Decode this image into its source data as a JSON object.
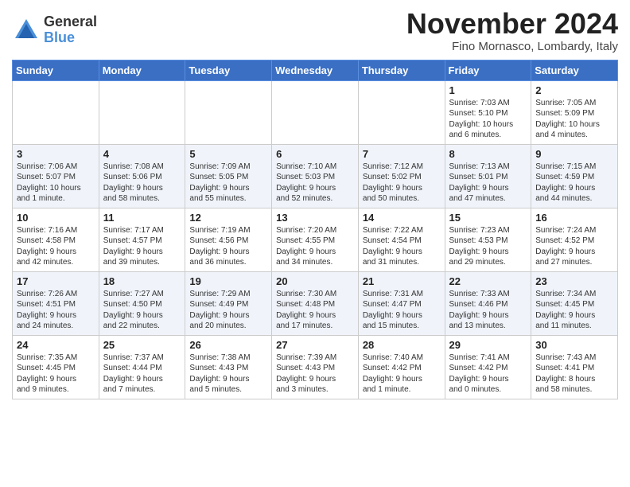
{
  "logo": {
    "general": "General",
    "blue": "Blue"
  },
  "title": "November 2024",
  "location": "Fino Mornasco, Lombardy, Italy",
  "days_of_week": [
    "Sunday",
    "Monday",
    "Tuesday",
    "Wednesday",
    "Thursday",
    "Friday",
    "Saturday"
  ],
  "weeks": [
    [
      {
        "day": "",
        "info": ""
      },
      {
        "day": "",
        "info": ""
      },
      {
        "day": "",
        "info": ""
      },
      {
        "day": "",
        "info": ""
      },
      {
        "day": "",
        "info": ""
      },
      {
        "day": "1",
        "info": "Sunrise: 7:03 AM\nSunset: 5:10 PM\nDaylight: 10 hours\nand 6 minutes."
      },
      {
        "day": "2",
        "info": "Sunrise: 7:05 AM\nSunset: 5:09 PM\nDaylight: 10 hours\nand 4 minutes."
      }
    ],
    [
      {
        "day": "3",
        "info": "Sunrise: 7:06 AM\nSunset: 5:07 PM\nDaylight: 10 hours\nand 1 minute."
      },
      {
        "day": "4",
        "info": "Sunrise: 7:08 AM\nSunset: 5:06 PM\nDaylight: 9 hours\nand 58 minutes."
      },
      {
        "day": "5",
        "info": "Sunrise: 7:09 AM\nSunset: 5:05 PM\nDaylight: 9 hours\nand 55 minutes."
      },
      {
        "day": "6",
        "info": "Sunrise: 7:10 AM\nSunset: 5:03 PM\nDaylight: 9 hours\nand 52 minutes."
      },
      {
        "day": "7",
        "info": "Sunrise: 7:12 AM\nSunset: 5:02 PM\nDaylight: 9 hours\nand 50 minutes."
      },
      {
        "day": "8",
        "info": "Sunrise: 7:13 AM\nSunset: 5:01 PM\nDaylight: 9 hours\nand 47 minutes."
      },
      {
        "day": "9",
        "info": "Sunrise: 7:15 AM\nSunset: 4:59 PM\nDaylight: 9 hours\nand 44 minutes."
      }
    ],
    [
      {
        "day": "10",
        "info": "Sunrise: 7:16 AM\nSunset: 4:58 PM\nDaylight: 9 hours\nand 42 minutes."
      },
      {
        "day": "11",
        "info": "Sunrise: 7:17 AM\nSunset: 4:57 PM\nDaylight: 9 hours\nand 39 minutes."
      },
      {
        "day": "12",
        "info": "Sunrise: 7:19 AM\nSunset: 4:56 PM\nDaylight: 9 hours\nand 36 minutes."
      },
      {
        "day": "13",
        "info": "Sunrise: 7:20 AM\nSunset: 4:55 PM\nDaylight: 9 hours\nand 34 minutes."
      },
      {
        "day": "14",
        "info": "Sunrise: 7:22 AM\nSunset: 4:54 PM\nDaylight: 9 hours\nand 31 minutes."
      },
      {
        "day": "15",
        "info": "Sunrise: 7:23 AM\nSunset: 4:53 PM\nDaylight: 9 hours\nand 29 minutes."
      },
      {
        "day": "16",
        "info": "Sunrise: 7:24 AM\nSunset: 4:52 PM\nDaylight: 9 hours\nand 27 minutes."
      }
    ],
    [
      {
        "day": "17",
        "info": "Sunrise: 7:26 AM\nSunset: 4:51 PM\nDaylight: 9 hours\nand 24 minutes."
      },
      {
        "day": "18",
        "info": "Sunrise: 7:27 AM\nSunset: 4:50 PM\nDaylight: 9 hours\nand 22 minutes."
      },
      {
        "day": "19",
        "info": "Sunrise: 7:29 AM\nSunset: 4:49 PM\nDaylight: 9 hours\nand 20 minutes."
      },
      {
        "day": "20",
        "info": "Sunrise: 7:30 AM\nSunset: 4:48 PM\nDaylight: 9 hours\nand 17 minutes."
      },
      {
        "day": "21",
        "info": "Sunrise: 7:31 AM\nSunset: 4:47 PM\nDaylight: 9 hours\nand 15 minutes."
      },
      {
        "day": "22",
        "info": "Sunrise: 7:33 AM\nSunset: 4:46 PM\nDaylight: 9 hours\nand 13 minutes."
      },
      {
        "day": "23",
        "info": "Sunrise: 7:34 AM\nSunset: 4:45 PM\nDaylight: 9 hours\nand 11 minutes."
      }
    ],
    [
      {
        "day": "24",
        "info": "Sunrise: 7:35 AM\nSunset: 4:45 PM\nDaylight: 9 hours\nand 9 minutes."
      },
      {
        "day": "25",
        "info": "Sunrise: 7:37 AM\nSunset: 4:44 PM\nDaylight: 9 hours\nand 7 minutes."
      },
      {
        "day": "26",
        "info": "Sunrise: 7:38 AM\nSunset: 4:43 PM\nDaylight: 9 hours\nand 5 minutes."
      },
      {
        "day": "27",
        "info": "Sunrise: 7:39 AM\nSunset: 4:43 PM\nDaylight: 9 hours\nand 3 minutes."
      },
      {
        "day": "28",
        "info": "Sunrise: 7:40 AM\nSunset: 4:42 PM\nDaylight: 9 hours\nand 1 minute."
      },
      {
        "day": "29",
        "info": "Sunrise: 7:41 AM\nSunset: 4:42 PM\nDaylight: 9 hours\nand 0 minutes."
      },
      {
        "day": "30",
        "info": "Sunrise: 7:43 AM\nSunset: 4:41 PM\nDaylight: 8 hours\nand 58 minutes."
      }
    ]
  ]
}
